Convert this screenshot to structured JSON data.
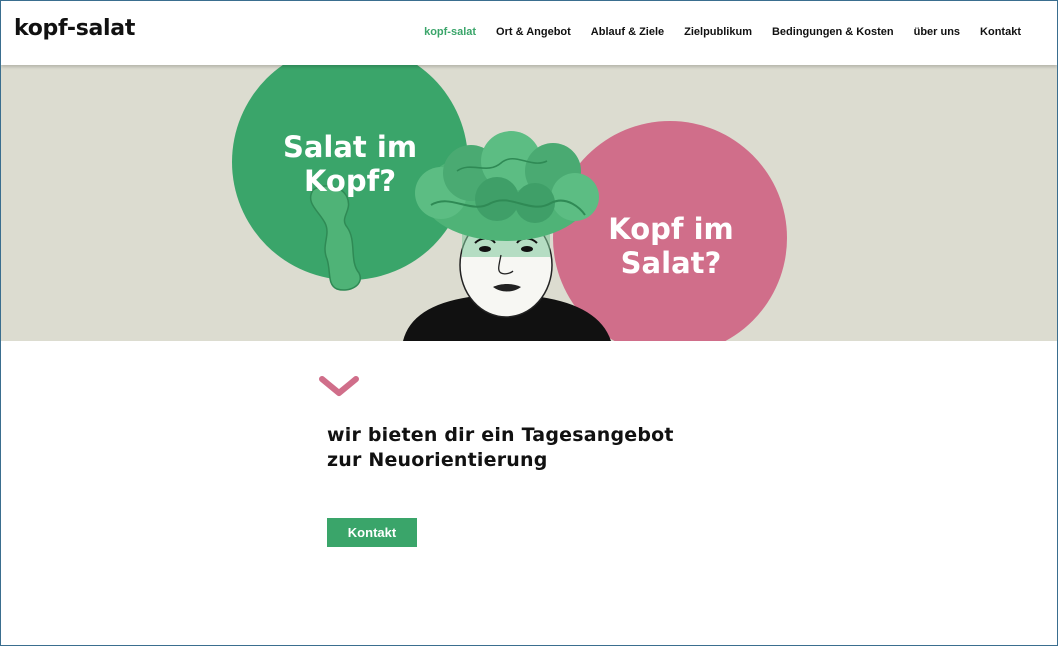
{
  "brand": {
    "logo_text": "kopf-salat"
  },
  "nav": {
    "items": [
      {
        "label": "kopf-salat",
        "active": true
      },
      {
        "label": "Ort & Angebot",
        "active": false
      },
      {
        "label": "Ablauf & Ziele",
        "active": false
      },
      {
        "label": "Zielpublikum",
        "active": false
      },
      {
        "label": "Bedingungen & Kosten",
        "active": false
      },
      {
        "label": "über uns",
        "active": false
      },
      {
        "label": "Kontakt",
        "active": false
      }
    ]
  },
  "hero": {
    "green_circle": {
      "line1": "Salat im",
      "line2": "Kopf?"
    },
    "pink_circle": {
      "line1": "Kopf im",
      "line2": "Salat?"
    }
  },
  "content": {
    "headline_line1": "wir bieten dir ein Tagesangebot",
    "headline_line2": "zur Neuorientierung",
    "cta_label": "Kontakt"
  },
  "colors": {
    "accent_green": "#3aa56a",
    "accent_pink": "#d06e8a",
    "hero_bg": "#dcdcd0",
    "text": "#111111"
  },
  "icons": {
    "scroll_indicator": "chevron-down-icon"
  }
}
